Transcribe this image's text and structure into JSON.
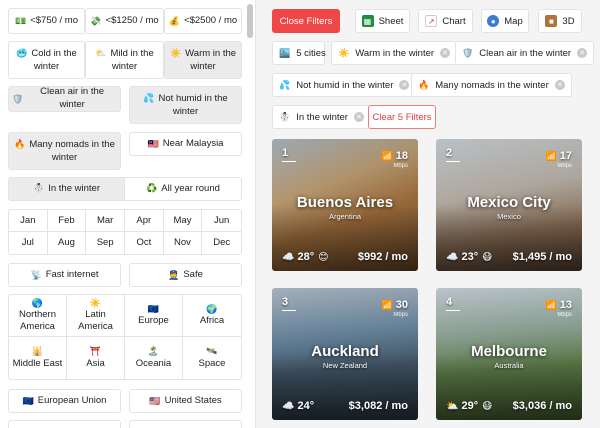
{
  "sidebar": {
    "cost_filters": [
      {
        "icon": "💵",
        "label": "<$750 / mo"
      },
      {
        "icon": "💸",
        "label": "<$1250 / mo"
      },
      {
        "icon": "💰",
        "label": "<$2500 / mo"
      }
    ],
    "winter_filters": [
      {
        "icon": "🥶",
        "label": "Cold in the winter"
      },
      {
        "icon": "⛅",
        "label": "Mild in the winter"
      },
      {
        "icon": "☀️",
        "label": "Warm in the winter"
      }
    ],
    "air_label": "Clean air in the winter",
    "humid_label": "Not humid in the winter",
    "nomads_label": "Many nomads in the winter",
    "near_label": "Near Malaysia",
    "season_in": "In the winter",
    "season_all": "All year round",
    "months": [
      "Jan",
      "Feb",
      "Mar",
      "Apr",
      "May",
      "Jun",
      "Jul",
      "Aug",
      "Sep",
      "Oct",
      "Nov",
      "Dec"
    ],
    "fast_internet": "Fast internet",
    "safe": "Safe",
    "regions": [
      {
        "icon": "🌎",
        "label": "Northern America"
      },
      {
        "icon": "☀️",
        "label": "Latin America"
      },
      {
        "icon": "🇪🇺",
        "label": "Europe"
      },
      {
        "icon": "🌍",
        "label": "Africa"
      },
      {
        "icon": "🕌",
        "label": "Middle East"
      },
      {
        "icon": "⛩️",
        "label": "Asia"
      },
      {
        "icon": "🏝️",
        "label": "Oceania"
      },
      {
        "icon": "🛰️",
        "label": "Space"
      }
    ],
    "european_union": "European Union",
    "united_states": "United States"
  },
  "toolbar": {
    "close_filters": "Close Filters",
    "sheet": "Sheet",
    "chart": "Chart",
    "map": "Map",
    "three_d": "3D"
  },
  "active_filters": {
    "count_label": "5 cities",
    "chips": [
      "Warm in the winter",
      "Clean air in the winter",
      "Not humid in the winter",
      "Many nomads in the winter",
      "In the winter"
    ],
    "clear_label": "Clear 5 Filters"
  },
  "cities": [
    {
      "rank": "1",
      "name": "Buenos Aires",
      "country": "Argentina",
      "speed": "18",
      "speed_unit": "Mbps",
      "temp": "28°",
      "cost": "$992 / mo"
    },
    {
      "rank": "2",
      "name": "Mexico City",
      "country": "Mexico",
      "speed": "17",
      "speed_unit": "Mbps",
      "temp": "23°",
      "cost": "$1,495 / mo"
    },
    {
      "rank": "3",
      "name": "Auckland",
      "country": "New Zealand",
      "speed": "30",
      "speed_unit": "Mbps",
      "temp": "24°",
      "cost": "$3,082 / mo"
    },
    {
      "rank": "4",
      "name": "Melbourne",
      "country": "Australia",
      "speed": "13",
      "speed_unit": "Mbps",
      "temp": "29°",
      "cost": "$3,036 / mo"
    }
  ],
  "colors": {
    "accent": "#ef4747",
    "clear": "#e03b3b"
  }
}
